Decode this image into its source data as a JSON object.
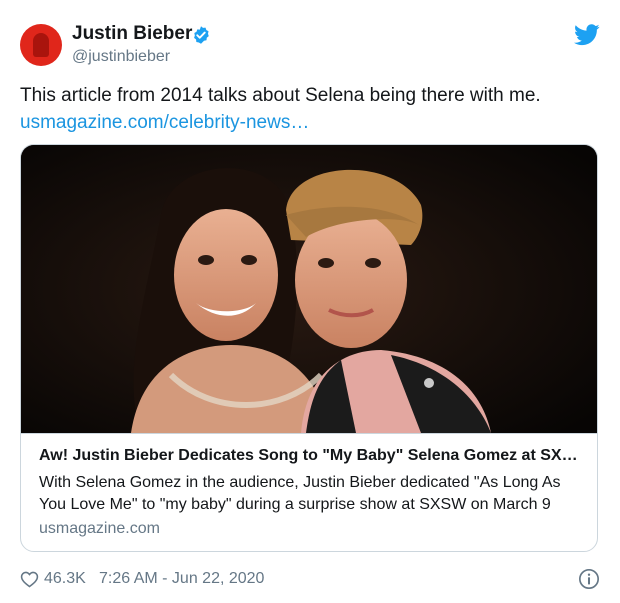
{
  "user": {
    "display_name": "Justin Bieber",
    "handle": "@justinbieber",
    "verified": true,
    "avatar_color": "#e0261b"
  },
  "tweet": {
    "text": "This article from 2014 talks about Selena being there with me.",
    "link_text": "usmagazine.com/celebrity-news…"
  },
  "card": {
    "title": "Aw! Justin Bieber Dedicates Song to \"My Baby\" Selena Gomez at SX…",
    "description": "With Selena Gomez in the audience, Justin Bieber dedicated \"As Long As You Love Me\" to \"my baby\" during a surprise show at SXSW on March 9",
    "domain": "usmagazine.com"
  },
  "footer": {
    "like_count": "46.3K",
    "timestamp": "7:26 AM - Jun 22, 2020"
  },
  "icons": {
    "brand": "twitter-bird-icon",
    "verified": "verified-badge-icon",
    "like": "heart-icon",
    "info": "info-icon"
  },
  "colors": {
    "link": "#1b95e0",
    "twitter_blue": "#1da1f2",
    "secondary_text": "#657786",
    "border": "#ccd6dd"
  }
}
